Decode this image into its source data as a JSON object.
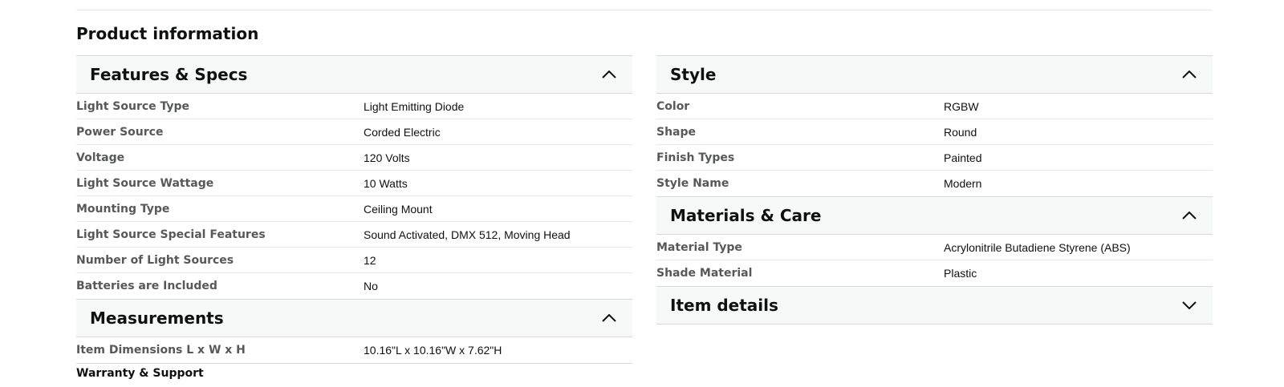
{
  "page": {
    "title": "Product information"
  },
  "left": {
    "features": {
      "title": "Features & Specs",
      "rows": [
        {
          "label": "Light Source Type",
          "value": "Light Emitting Diode"
        },
        {
          "label": "Power Source",
          "value": "Corded Electric"
        },
        {
          "label": "Voltage",
          "value": "120 Volts"
        },
        {
          "label": "Light Source Wattage",
          "value": "10 Watts"
        },
        {
          "label": "Mounting Type",
          "value": "Ceiling Mount"
        },
        {
          "label": "Light Source Special Features",
          "value": "Sound Activated, DMX 512, Moving Head"
        },
        {
          "label": "Number of Light Sources",
          "value": "12"
        },
        {
          "label": "Batteries are Included",
          "value": "No"
        }
      ]
    },
    "measurements": {
      "title": "Measurements",
      "rows": [
        {
          "label": "Item Dimensions L x W x H",
          "value": "10.16\"L x 10.16\"W x 7.62\"H"
        }
      ]
    },
    "warranty_heading": "Warranty & Support"
  },
  "right": {
    "style": {
      "title": "Style",
      "rows": [
        {
          "label": "Color",
          "value": "RGBW"
        },
        {
          "label": "Shape",
          "value": "Round"
        },
        {
          "label": "Finish Types",
          "value": "Painted"
        },
        {
          "label": "Style Name",
          "value": "Modern"
        }
      ]
    },
    "materials": {
      "title": "Materials & Care",
      "rows": [
        {
          "label": "Material Type",
          "value": "Acrylonitrile Butadiene Styrene (ABS)"
        },
        {
          "label": "Shade Material",
          "value": "Plastic"
        }
      ]
    },
    "item_details": {
      "title": "Item details"
    }
  },
  "icons": {
    "expanded": "chevron-up-icon",
    "collapsed": "chevron-down-icon"
  }
}
